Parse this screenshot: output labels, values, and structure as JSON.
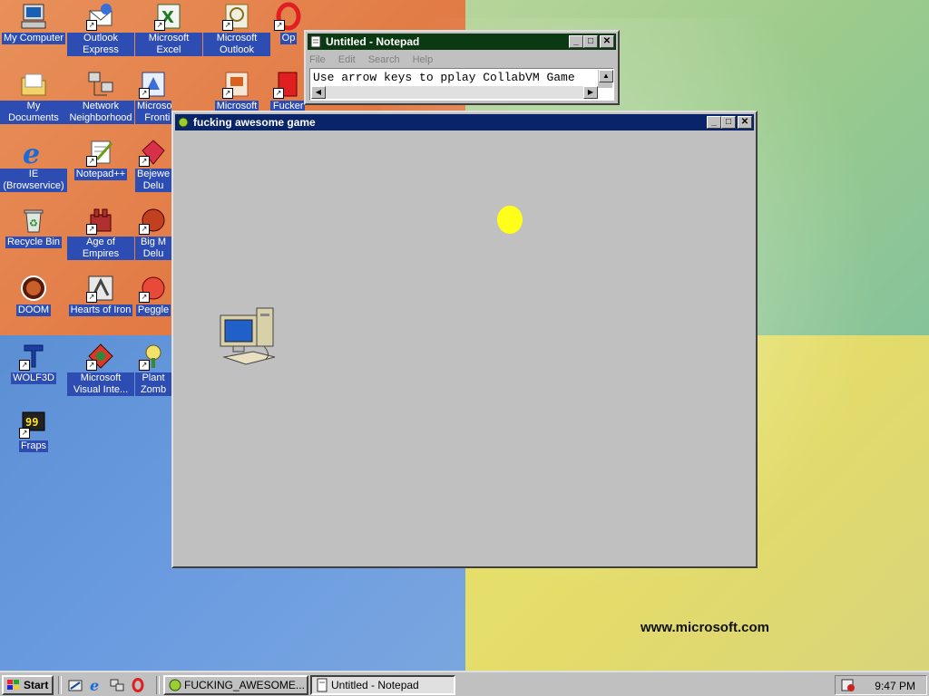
{
  "desktop": {
    "watermark": "www.microsoft.com",
    "icons": [
      {
        "label": "My Computer"
      },
      {
        "label": "Outlook Express"
      },
      {
        "label": "Microsoft Excel"
      },
      {
        "label": "Microsoft Outlook"
      },
      {
        "label": "Op"
      },
      {
        "label": "My Documents"
      },
      {
        "label": "Network Neighborhood"
      },
      {
        "label": "Microsoft Fronti"
      },
      {
        "label": "Microsoft"
      },
      {
        "label": "Fucker Google"
      },
      {
        "label": "IE (Browservice)"
      },
      {
        "label": "Notepad++"
      },
      {
        "label": "Bejewe Delu"
      },
      {
        "label": "Recycle Bin"
      },
      {
        "label": "Age of Empires"
      },
      {
        "label": "Big M Delu"
      },
      {
        "label": "DOOM"
      },
      {
        "label": "Hearts of Iron"
      },
      {
        "label": "Peggle"
      },
      {
        "label": "WOLF3D"
      },
      {
        "label": "Microsoft Visual Inte..."
      },
      {
        "label": "Plant Zomb"
      },
      {
        "label": "Fraps"
      }
    ]
  },
  "notepad": {
    "title": "Untitled - Notepad",
    "menu": [
      "File",
      "Edit",
      "Search",
      "Help"
    ],
    "content": "Use arrow keys to pplay CollabVM Game"
  },
  "game": {
    "title": "fucking awesome game",
    "ball_color": "#ffff1a"
  },
  "taskbar": {
    "start_label": "Start",
    "tasks": [
      {
        "label": "FUCKING_AWESOME..."
      },
      {
        "label": "Untitled - Notepad"
      }
    ],
    "clock": "9:47 PM"
  }
}
